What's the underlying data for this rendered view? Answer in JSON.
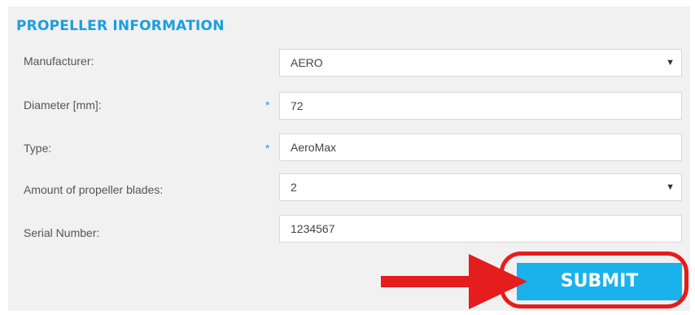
{
  "section": {
    "title": "PROPELLER INFORMATION"
  },
  "form": {
    "manufacturer": {
      "label": "Manufacturer:",
      "value": "AERO",
      "caret": "▼"
    },
    "diameter": {
      "label": "Diameter [mm]:",
      "required_mark": "*",
      "value": "72"
    },
    "type": {
      "label": "Type:",
      "required_mark": "*",
      "value": "AeroMax"
    },
    "blades": {
      "label": "Amount of propeller blades:",
      "value": "2",
      "caret": "▼"
    },
    "serial": {
      "label": "Serial Number:",
      "value": "1234567"
    },
    "submit_label": "SUBMIT"
  },
  "colors": {
    "accent": "#1a9fe0",
    "button": "#1ab2ec",
    "annotation": "#e51d1d",
    "panel_bg": "#f1f1f1"
  }
}
